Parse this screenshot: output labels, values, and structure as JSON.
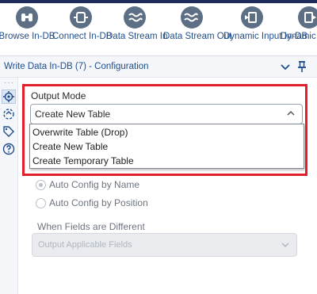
{
  "toolbar": {
    "tools": [
      {
        "label": "Browse In-DB",
        "icon": "binoculars-icon"
      },
      {
        "label": "Connect In-DB",
        "icon": "connect-icon"
      },
      {
        "label": "Data Stream In",
        "icon": "data-stream-in-icon"
      },
      {
        "label": "Data Stream Out",
        "icon": "data-stream-out-icon"
      },
      {
        "label": "Dynamic Input In-DB",
        "icon": "dynamic-input-icon"
      },
      {
        "label": "Dynamic Output In-DB",
        "icon": "dynamic-output-icon"
      }
    ]
  },
  "config": {
    "title": "Write Data In-DB (7) - Configuration"
  },
  "output_mode": {
    "label": "Output Mode",
    "selected": "Create New Table",
    "options": [
      "Overwrite Table (Drop)",
      "Create New Table",
      "Create Temporary Table"
    ]
  },
  "field_mapping": {
    "options": [
      {
        "label": "Auto Config by Name",
        "selected": true
      },
      {
        "label": "Auto Config by Position",
        "selected": false
      }
    ],
    "when_different_label": "When Fields are Different",
    "when_different_value": "Output Applicable Fields"
  },
  "colors": {
    "accent": "#1f4e8c",
    "highlight_border": "#e0202a",
    "icon_fill": "#5d6f85",
    "top_strip": "#1f2d5c"
  }
}
